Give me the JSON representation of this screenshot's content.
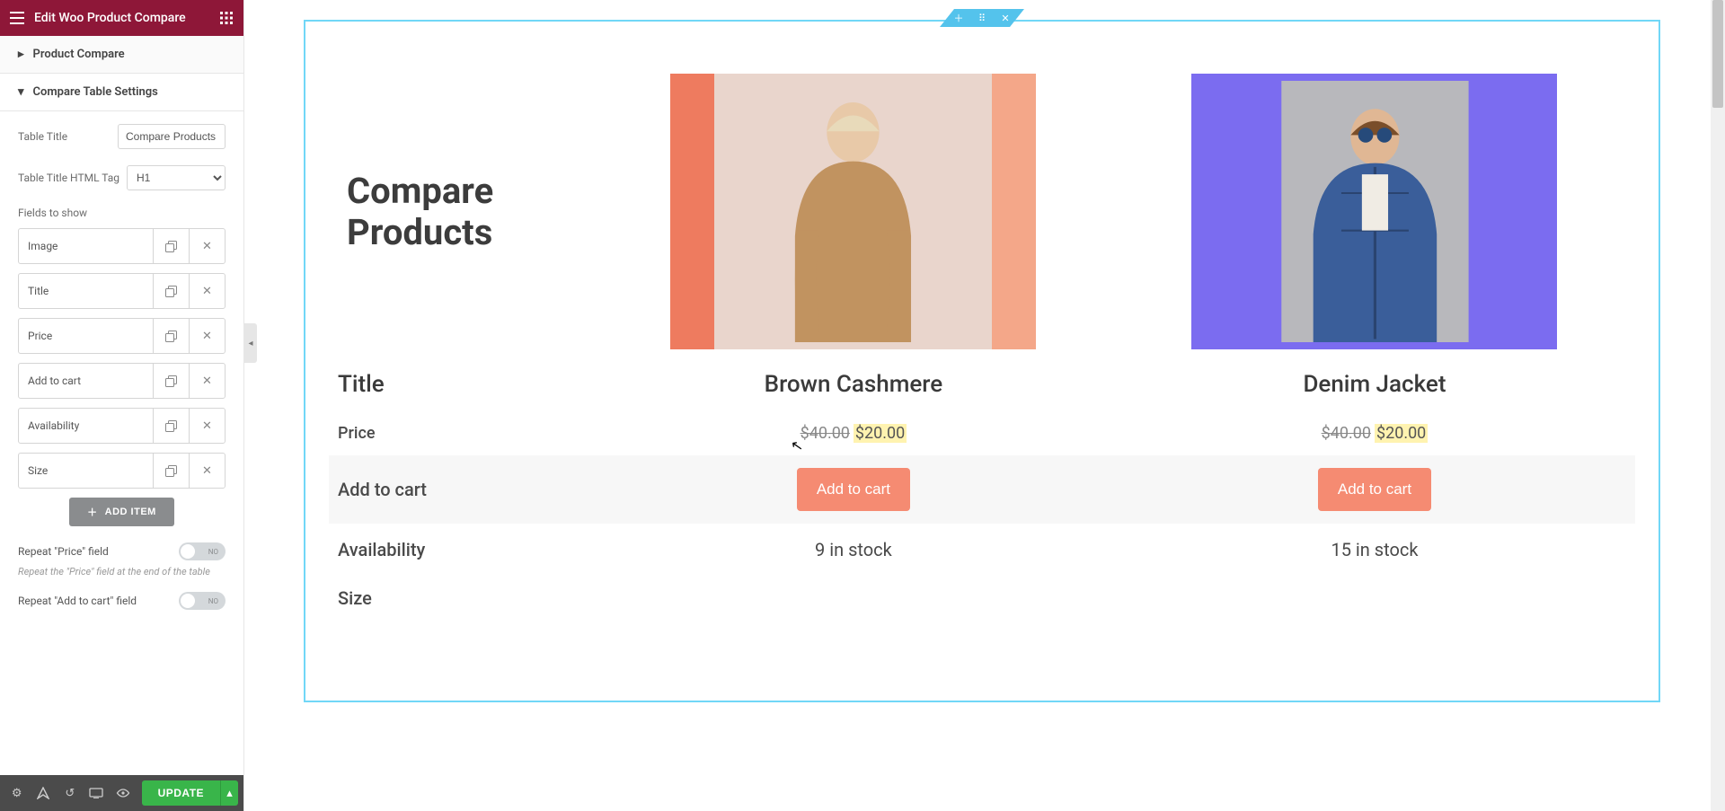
{
  "header": {
    "title": "Edit Woo Product Compare"
  },
  "sections": {
    "productCompare": "Product Compare",
    "tableSettings": "Compare Table Settings"
  },
  "controls": {
    "tableTitleLabel": "Table Title",
    "tableTitleValue": "Compare Products",
    "htmlTagLabel": "Table Title HTML Tag",
    "htmlTagValue": "H1",
    "fieldsLabel": "Fields to show",
    "fields": [
      {
        "name": "Image"
      },
      {
        "name": "Title"
      },
      {
        "name": "Price"
      },
      {
        "name": "Add to cart"
      },
      {
        "name": "Availability"
      },
      {
        "name": "Size"
      }
    ],
    "addItem": "ADD ITEM",
    "repeatPriceLabel": "Repeat \"Price\" field",
    "repeatPriceHint": "Repeat the \"Price\" field at the end of the table",
    "repeatCartLabel": "Repeat \"Add to cart\" field",
    "toggleNo": "NO"
  },
  "footer": {
    "update": "UPDATE"
  },
  "preview": {
    "mainTitle": "Compare Products",
    "rows": {
      "title": "Title",
      "price": "Price",
      "cart": "Add to cart",
      "availability": "Availability",
      "size": "Size"
    },
    "products": [
      {
        "title": "Brown Cashmere",
        "priceOld": "$40.00",
        "priceNew": "$20.00",
        "cart": "Add to cart",
        "availability": "9 in stock"
      },
      {
        "title": "Denim Jacket",
        "priceOld": "$40.00",
        "priceNew": "$20.00",
        "cart": "Add to cart",
        "availability": "15 in stock"
      }
    ]
  }
}
